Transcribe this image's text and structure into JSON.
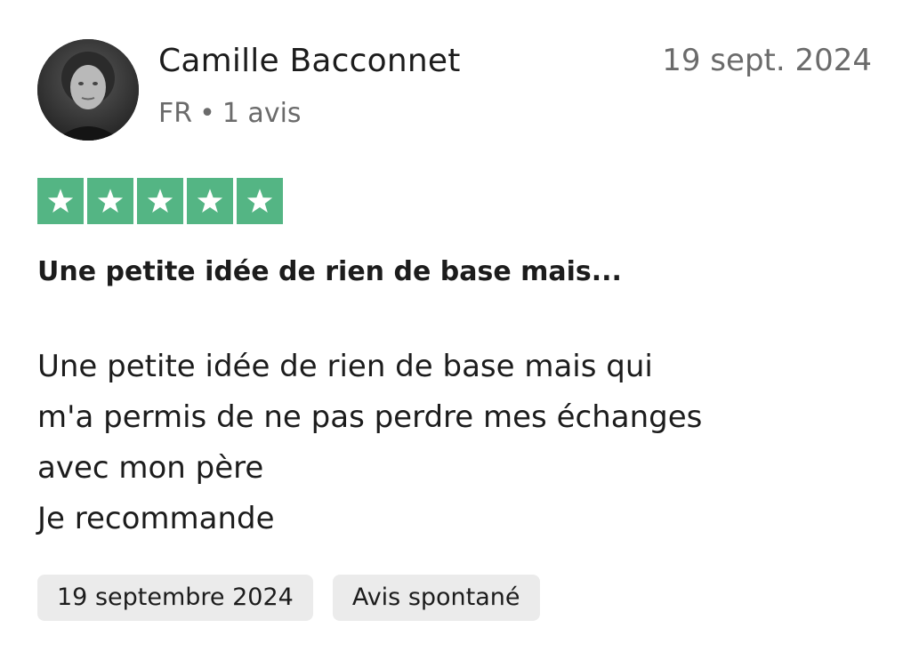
{
  "reviewer": {
    "name": "Camille Bacconnet",
    "country": "FR",
    "separator": "•",
    "review_count": "1 avis",
    "avatar_icon": "avatar-photo"
  },
  "review": {
    "date_short": "19 sept. 2024",
    "rating": 5,
    "rating_max": 5,
    "star_color": "#54b584",
    "title": "Une petite idée de rien de base mais...",
    "body_lines": [
      "Une petite idée de rien de base mais qui",
      "m'a permis de ne pas perdre mes échanges",
      "avec mon père",
      "Je recommande"
    ]
  },
  "tags": [
    "19 septembre 2024",
    "Avis spontané"
  ]
}
